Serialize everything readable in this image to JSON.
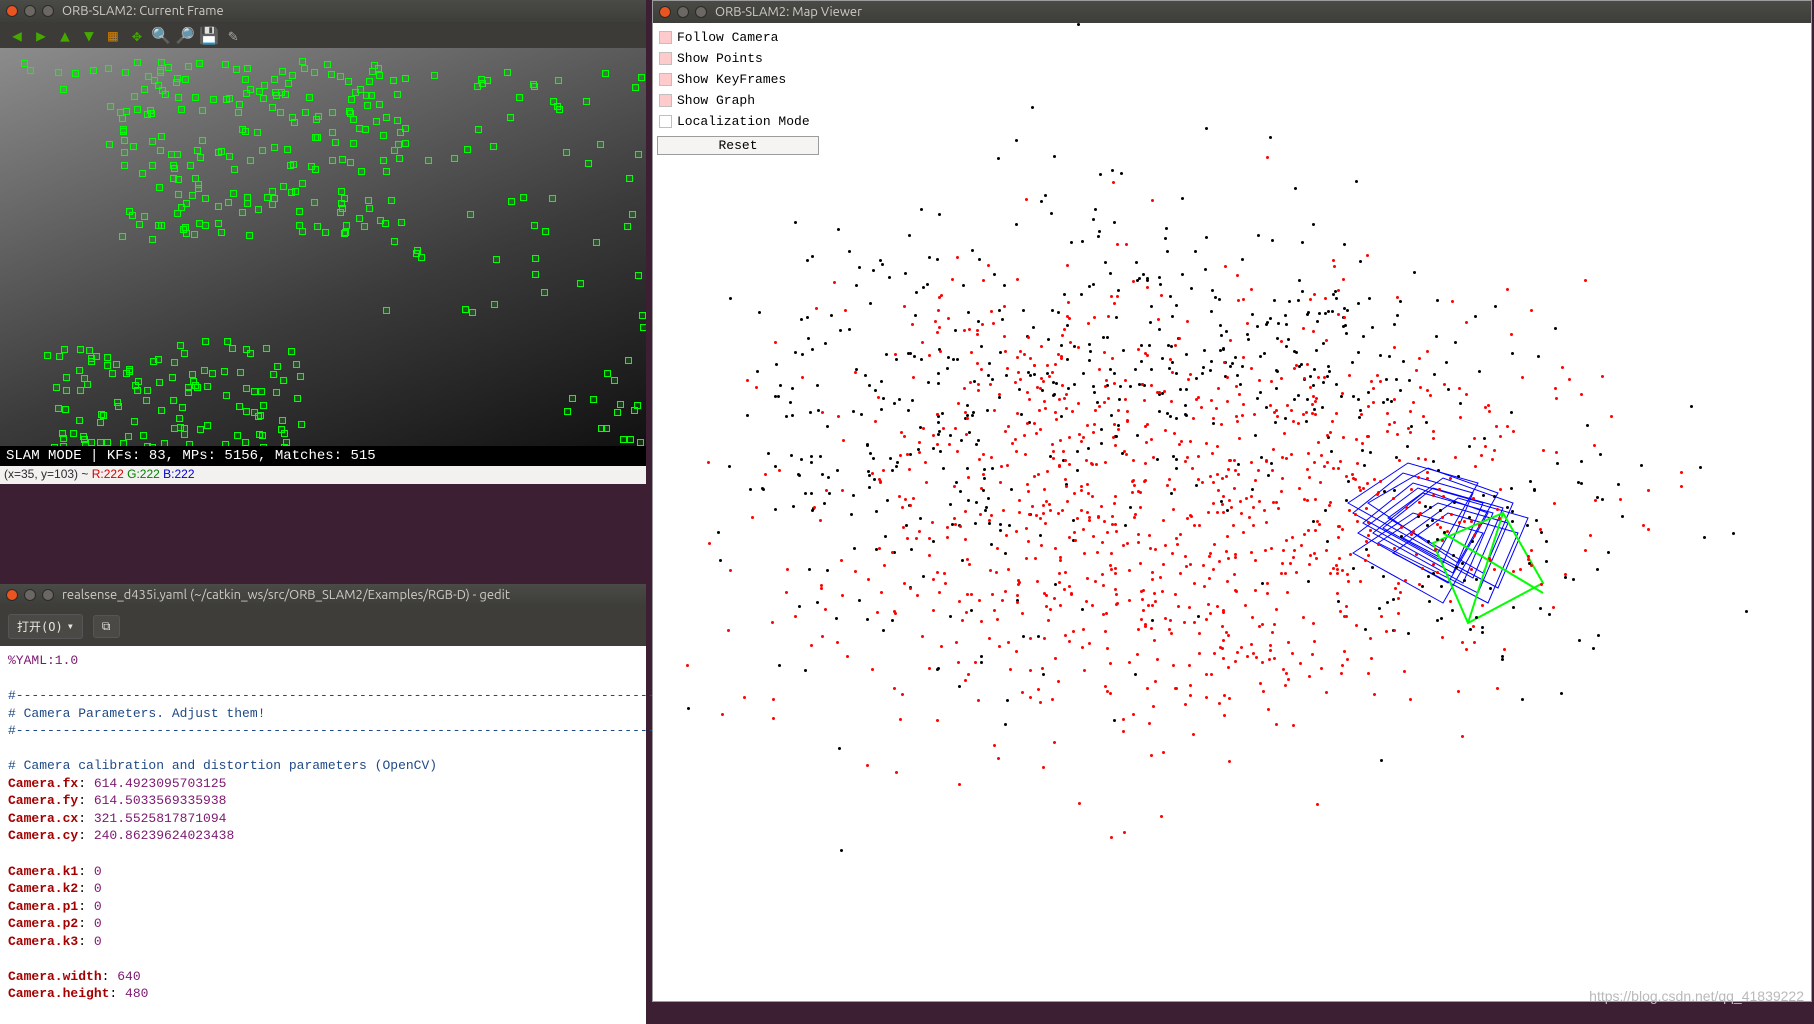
{
  "current_frame": {
    "title": "ORB-SLAM2: Current Frame",
    "slam_bar": "SLAM MODE |  KFs: 83, MPs: 5156, Matches: 515",
    "coord": {
      "pos": "(x=35, y=103) ~ ",
      "r": "R:222",
      "g": "G:222",
      "b": "B:222"
    },
    "toolbar_icons": [
      "arrow-left",
      "arrow-right",
      "arrow-up",
      "arrow-down",
      "home",
      "pan",
      "zoom-in",
      "zoom-out",
      "save",
      "brush"
    ]
  },
  "gedit": {
    "title": "realsense_d435i.yaml (~/catkin_ws/src/ORB_SLAM2/Examples/RGB-D) - gedit",
    "open_label": "打开(O)",
    "yaml": {
      "directive": "%YAML:1.0",
      "hdr_dash": "#--------------------------------------------------------------------------------------------",
      "hdr_title": "# Camera Parameters. Adjust them!",
      "calib_cmt": "# Camera calibration and distortion parameters (OpenCV)",
      "fx_k": "Camera.fx",
      "fx_v": "614.4923095703125",
      "fy_k": "Camera.fy",
      "fy_v": "614.5033569335938",
      "cx_k": "Camera.cx",
      "cx_v": "321.5525817871094",
      "cy_k": "Camera.cy",
      "cy_v": "240.86239624023438",
      "k1_k": "Camera.k1",
      "k1_v": "0",
      "k2_k": "Camera.k2",
      "k2_v": "0",
      "p1_k": "Camera.p1",
      "p1_v": "0",
      "p2_k": "Camera.p2",
      "p2_v": "0",
      "k3_k": "Camera.k3",
      "k3_v": "0",
      "w_k": "Camera.width",
      "w_v": "640",
      "h_k": "Camera.height",
      "h_v": "480"
    }
  },
  "map_viewer": {
    "title": "ORB-SLAM2: Map Viewer",
    "options": {
      "follow_camera": "Follow Camera",
      "show_points": "Show Points",
      "show_keyframes": "Show KeyFrames",
      "show_graph": "Show Graph",
      "localization": "Localization Mode"
    },
    "reset": "Reset"
  },
  "watermark": "https://blog.csdn.net/qq_41839222"
}
